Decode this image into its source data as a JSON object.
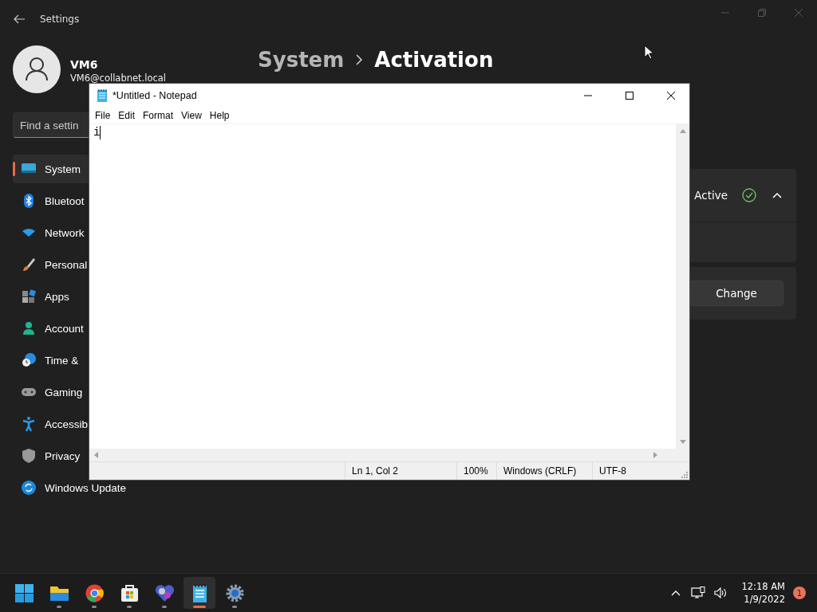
{
  "settings": {
    "title": "Settings",
    "user": {
      "name": "VM6",
      "email": "VM6@collabnet.local"
    },
    "search": {
      "placeholder": "Find a settin"
    },
    "nav": [
      {
        "label": "System",
        "kind": "system",
        "selected": true
      },
      {
        "label": "Bluetoot",
        "kind": "bluetooth",
        "selected": false
      },
      {
        "label": "Network",
        "kind": "network",
        "selected": false
      },
      {
        "label": "Personal",
        "kind": "brush",
        "selected": false
      },
      {
        "label": "Apps",
        "kind": "apps",
        "selected": false
      },
      {
        "label": "Account",
        "kind": "account",
        "selected": false
      },
      {
        "label": "Time &",
        "kind": "time",
        "selected": false
      },
      {
        "label": "Gaming",
        "kind": "gaming",
        "selected": false
      },
      {
        "label": "Accessib",
        "kind": "accessibility",
        "selected": false
      },
      {
        "label": "Privacy",
        "kind": "privacy",
        "selected": false
      },
      {
        "label": "Windows Update",
        "kind": "update",
        "selected": false
      }
    ],
    "breadcrumb": [
      "System",
      "Activation"
    ],
    "activation": {
      "status": "Active",
      "expanded": true
    },
    "change_button": "Change"
  },
  "notepad": {
    "title": "*Untitled - Notepad",
    "menu": [
      "File",
      "Edit",
      "Format",
      "View",
      "Help"
    ],
    "text": "i",
    "status": [
      "Ln 1, Col 2",
      "100%",
      "Windows (CRLF)",
      "UTF-8"
    ]
  },
  "taskbar": {
    "apps": [
      {
        "kind": "start",
        "running": false,
        "active": false
      },
      {
        "kind": "folder",
        "running": true,
        "active": false
      },
      {
        "kind": "browser",
        "running": true,
        "active": false
      },
      {
        "kind": "store",
        "running": true,
        "active": false
      },
      {
        "kind": "media",
        "running": true,
        "active": false
      },
      {
        "kind": "notepad",
        "running": true,
        "active": true
      },
      {
        "kind": "settings",
        "running": true,
        "active": false
      }
    ],
    "clock": {
      "time": "12:18 AM",
      "date": "1/9/2022"
    },
    "notifications": "1"
  }
}
